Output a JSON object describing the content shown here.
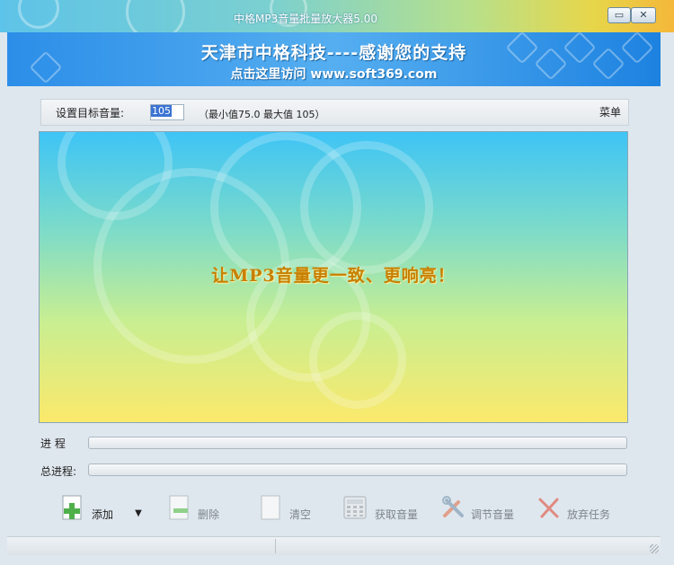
{
  "window": {
    "title": "中格MP3音量批量放大器5.00"
  },
  "titlebar": {
    "minimize_glyph": "▭",
    "close_glyph": "✕"
  },
  "banner": {
    "line1": "天津市中格科技----感谢您的支持",
    "line2": "点击这里访问 www.soft369.com"
  },
  "settings": {
    "target_label": "设置目标音量:",
    "target_value": "105",
    "range_text": "（最小值75.0   最大值 105）",
    "menu_label": "菜单"
  },
  "panel": {
    "slogan": "让MP3音量更一致、更响亮！"
  },
  "progress": {
    "label": "进    程",
    "value": 0
  },
  "total_progress": {
    "label": "总进程:",
    "value": 0
  },
  "toolbar": {
    "add": "添加",
    "dropdown_glyph": "▼",
    "delete": "删除",
    "clear": "清空",
    "get_volume": "获取音量",
    "adjust_volume": "调节音量",
    "abort": "放弃任务"
  },
  "colors": {
    "accent": "#2c8ee8",
    "slogan": "#c87f00",
    "add_green": "#4fb04a",
    "abort_red": "#d85a4a"
  }
}
